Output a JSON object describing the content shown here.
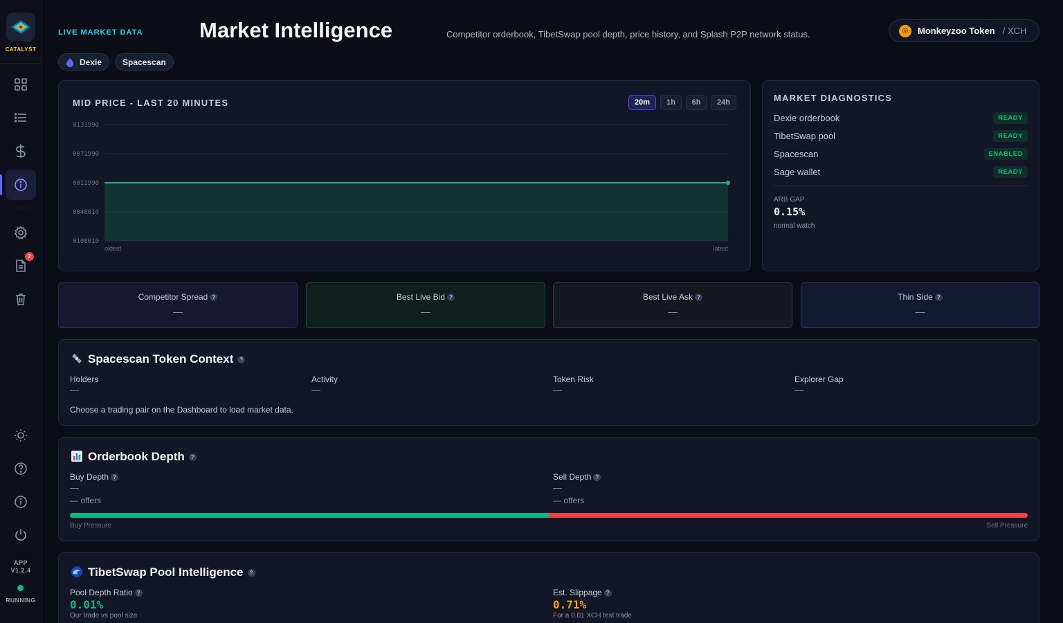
{
  "app": {
    "logo_text": "CATALYST",
    "version_label": "APP",
    "version": "V1.2.4",
    "status": "RUNNING",
    "notif_count": "2"
  },
  "header": {
    "live_label": "LIVE MARKET DATA",
    "title": "Market Intelligence",
    "subtitle": "Competitor orderbook, TibetSwap pool depth, price history, and Splash P2P network status.",
    "token_name": "Monkeyzoo Token",
    "token_quote": "/ XCH",
    "sources": [
      "Dexie",
      "Spacescan"
    ]
  },
  "price_chart": {
    "title": "MID PRICE - LAST 20 MINUTES",
    "timeframes": [
      "20m",
      "1h",
      "6h",
      "24h"
    ],
    "active_timeframe": "20m",
    "x_start_label": "oldest",
    "x_end_label": "latest"
  },
  "chart_data": {
    "type": "area",
    "title": "MID PRICE - LAST 20 MINUTES",
    "y_tick_labels": [
      "0131990",
      "0071990",
      "0011990",
      "0048010",
      "0108010"
    ],
    "ylim_index": [
      0,
      4
    ],
    "series": [
      {
        "values": [
          0.001199,
          0.001199
        ]
      }
    ],
    "x": [
      "oldest",
      "latest"
    ],
    "grid": true,
    "color": "#10b981"
  },
  "diagnostics": {
    "title": "MARKET DIAGNOSTICS",
    "rows": [
      {
        "label": "Dexie orderbook",
        "status": "READY"
      },
      {
        "label": "TibetSwap pool",
        "status": "READY"
      },
      {
        "label": "Spacescan",
        "status": "ENABLED"
      },
      {
        "label": "Sage wallet",
        "status": "READY"
      }
    ],
    "arb_label": "ARB GAP",
    "arb_value": "0.15%",
    "arb_note": "normal watch"
  },
  "stats": [
    {
      "label": "Competitor Spread",
      "value": "—",
      "bg": "#181730",
      "border": "#2e2b55"
    },
    {
      "label": "Best Live Bid",
      "value": "—",
      "bg": "#0f1f1c",
      "border": "#1c4a3c"
    },
    {
      "label": "Best Live Ask",
      "value": "—",
      "bg": "#16181f",
      "border": "#343844"
    },
    {
      "label": "Thin Side",
      "value": "—",
      "bg": "#111933",
      "border": "#253662"
    }
  ],
  "spacescan": {
    "title": "Spacescan Token Context",
    "fields": [
      {
        "label": "Holders",
        "value": "—"
      },
      {
        "label": "Activity",
        "value": "—"
      },
      {
        "label": "Token Risk",
        "value": "—"
      },
      {
        "label": "Explorer Gap",
        "value": "—"
      }
    ],
    "note": "Choose a trading pair on the Dashboard to load market data."
  },
  "orderbook": {
    "title": "Orderbook Depth",
    "buy_label": "Buy Depth",
    "buy_value": "—",
    "buy_offers": "— offers",
    "sell_label": "Sell Depth",
    "sell_value": "—",
    "sell_offers": "— offers",
    "buy_pressure_label": "Buy Pressure",
    "sell_pressure_label": "Sell Pressure",
    "buy_fraction": 0.5
  },
  "tibetswap": {
    "title": "TibetSwap Pool Intelligence",
    "ratio_label": "Pool Depth Ratio",
    "ratio_value": "0.01%",
    "ratio_note": "Our trade vs pool size",
    "slippage_label": "Est. Slippage",
    "slippage_value": "0.71%",
    "slippage_note": "For a 0.01 XCH test trade"
  }
}
